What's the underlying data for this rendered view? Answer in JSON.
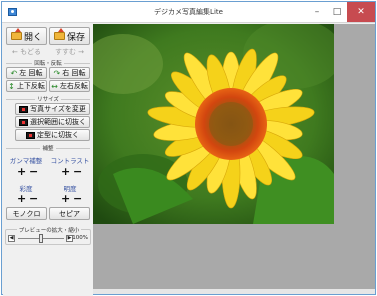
{
  "window": {
    "title": "デジカメ写真編集Lite",
    "minimize": "–",
    "maximize": "□",
    "close": "✕"
  },
  "toolbar": {
    "open_label": "開く",
    "save_label": "保存",
    "undo_label": "← もどる",
    "redo_label": "すすむ →"
  },
  "rotate_flip": {
    "group_label": "回転・反転",
    "rotate_left": "左 回転",
    "rotate_right": "右 回転",
    "flip_vertical": "上下反転",
    "flip_horizontal": "左右反転"
  },
  "resize": {
    "group_label": "リサイズ",
    "change_size": "写真サイズを変更",
    "crop_selection": "選択範囲に切抜く",
    "crop_fixed": "定型に切抜く"
  },
  "adjust": {
    "group_label": "補整",
    "gamma": "ガンマ補整",
    "contrast": "コントラスト",
    "saturation": "彩度",
    "brightness": "明度",
    "plus": "+",
    "minus": "−",
    "monochrome": "モノクロ",
    "sepia": "セピア"
  },
  "preview": {
    "group_label": "プレビューの拡大・縮小",
    "zoom_value": "100%",
    "zoom_level": 0.5
  },
  "colors": {
    "accent": "#3a55a3",
    "close": "#c74b50",
    "workspace": "#a9a9a9"
  }
}
